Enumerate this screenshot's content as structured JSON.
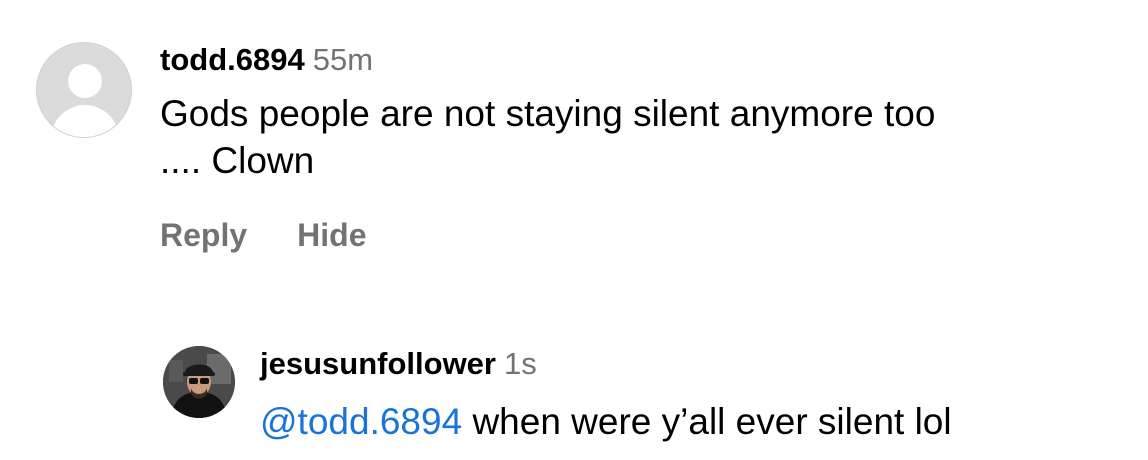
{
  "comment": {
    "username": "todd.6894",
    "time": "55m",
    "text_line1": "Gods people are not staying silent anymore too",
    "text_line2": ".... Clown",
    "reply_label": "Reply",
    "hide_label": "Hide",
    "avatar_icon": "default-avatar-icon"
  },
  "reply": {
    "username": "jesusunfollower",
    "time": "1s",
    "mention": "@todd.6894",
    "text": " when were y’all ever silent lol",
    "avatar_icon": "user-avatar-photo"
  },
  "colors": {
    "secondary_text": "#737373",
    "mention": "#1a73d9",
    "avatar_placeholder": "#dbdbdb"
  }
}
